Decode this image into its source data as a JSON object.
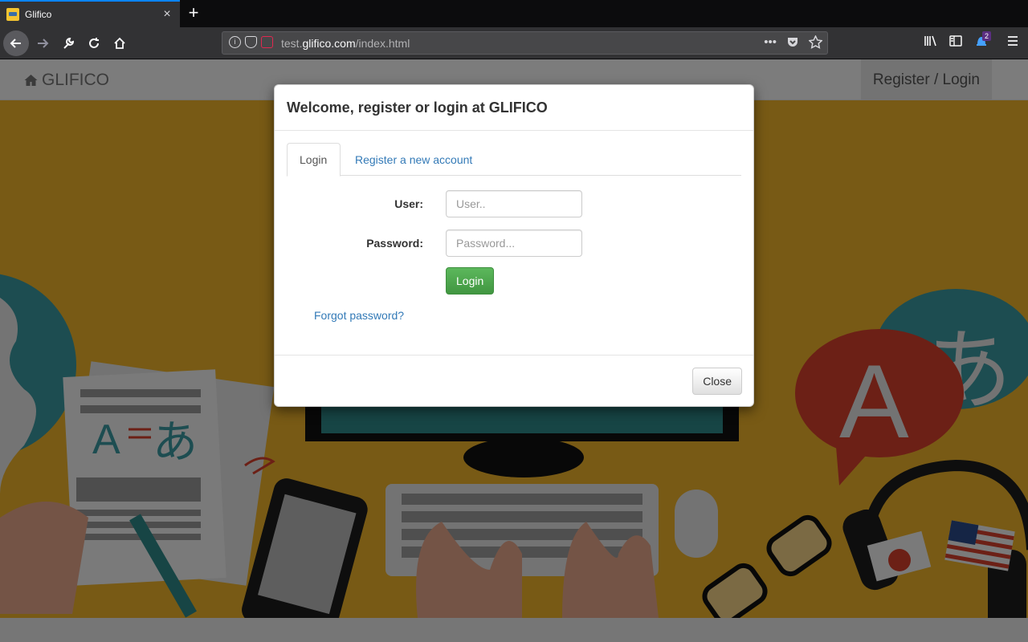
{
  "browser": {
    "tab_title": "Glifico",
    "tab_close": "×",
    "new_tab": "+",
    "url_prefix": "test.",
    "url_domain": "glifico.com",
    "url_path": "/index.html",
    "page_actions": "•••",
    "notification_badge": "2"
  },
  "site": {
    "brand": "GLIFICO",
    "register_login_link": "Register / Login"
  },
  "modal": {
    "title": "Welcome, register or login at GLIFICO",
    "tabs": [
      {
        "label": "Login",
        "active": true
      },
      {
        "label": "Register a new account",
        "active": false
      }
    ],
    "user_label": "User:",
    "user_placeholder": "User..",
    "password_label": "Password:",
    "password_placeholder": "Password...",
    "login_button": "Login",
    "forgot_password": "Forgot password?",
    "close_button": "Close"
  },
  "hero_letters": {
    "a_latin": "A",
    "hiragana": "あ"
  },
  "colors": {
    "hero_background": "#f0b52b",
    "primary_link": "#337ab7",
    "success_button": "#5cb85c",
    "browser_accent": "#0a84ff"
  }
}
